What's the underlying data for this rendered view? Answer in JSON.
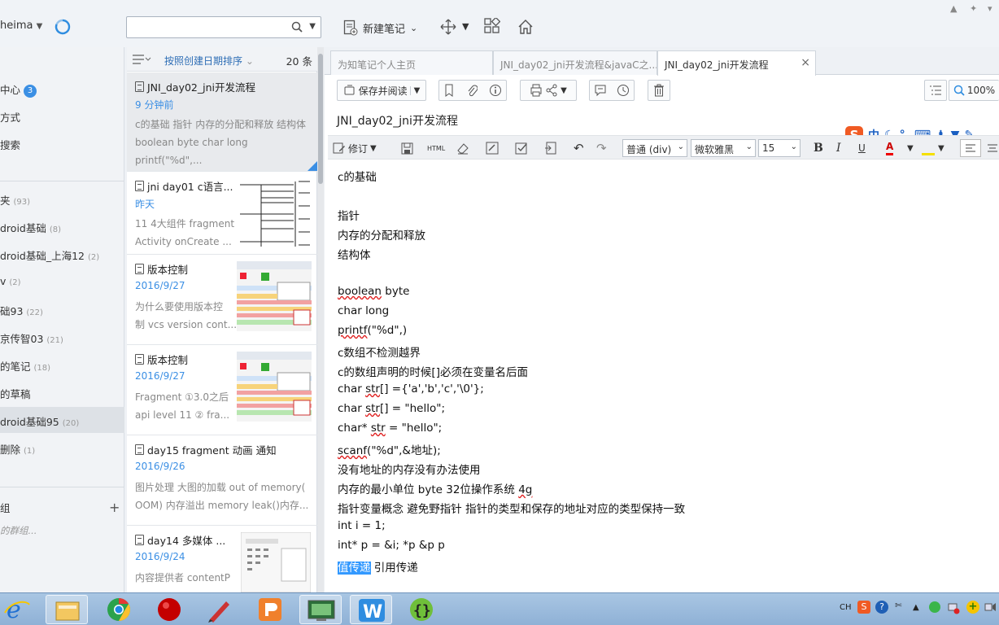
{
  "header": {
    "user": "heima",
    "search_placeholder": "",
    "new_note_label": "新建笔记"
  },
  "sidebar": {
    "items": [
      {
        "label": "中心",
        "badge": "3"
      },
      {
        "label": "方式"
      },
      {
        "label": "搜索"
      },
      {
        "label": "夹",
        "count": "(93)"
      },
      {
        "label": "droid基础",
        "count": "(8)"
      },
      {
        "label": "droid基础_上海12",
        "count": "(2)"
      },
      {
        "label": "v",
        "count": "(2)"
      },
      {
        "label": "础93",
        "count": "(22)"
      },
      {
        "label": "京传智03",
        "count": "(21)"
      },
      {
        "label": "的笔记",
        "count": "(18)"
      },
      {
        "label": "的草稿"
      },
      {
        "label": "droid基础95",
        "count": "(20)"
      },
      {
        "label": "删除",
        "count": "(1)"
      }
    ],
    "groups_label": "组",
    "groups_placeholder": "的群组..."
  },
  "notelist": {
    "sort_label": "按照创建日期排序",
    "count_label": "20 条",
    "notes": [
      {
        "title": "JNI_day02_jni开发流程",
        "date": "9 分钟前",
        "snippet1": "c的基础 指针 内存的分配和释放 结构体",
        "snippet2": "boolean byte char long printf(\"%d\",..."
      },
      {
        "title": "jni day01 c语言...",
        "date": "昨天",
        "snippet1": "11 4大组件 fragment",
        "snippet2": " Activity onCreate ..."
      },
      {
        "title": "版本控制",
        "date": "2016/9/27",
        "snippet1": "为什么要使用版本控",
        "snippet2": "制 vcs version cont..."
      },
      {
        "title": "版本控制",
        "date": "2016/9/27",
        "snippet1": "Fragment ①3.0之后",
        "snippet2": "api level 11 ② fra..."
      },
      {
        "title": "day15 fragment 动画 通知",
        "date": "2016/9/26",
        "snippet1": "图片处理 大图的加载 out of memory(",
        "snippet2": "OOM) 内存溢出 memory leak()内存..."
      },
      {
        "title": "day14 多媒体 ...",
        "date": "2016/9/24",
        "snippet1": "内容提供者 contentP",
        "snippet2": ""
      }
    ]
  },
  "tabs": [
    {
      "label": "为知笔记个人主页"
    },
    {
      "label": "JNI_day02_jni开发流程&javaC之..."
    },
    {
      "label": "JNI_day02_jni开发流程"
    }
  ],
  "actions": {
    "save_read": "保存并阅读",
    "zoom": "100%"
  },
  "note_title": "JNI_day02_jni开发流程",
  "format": {
    "edit_mode": "修订",
    "html_label": "HTML",
    "block": "普通 (div)",
    "font": "微软雅黑",
    "size": "15",
    "bold": "B",
    "italic": "I",
    "ime_label": "中"
  },
  "content": {
    "l1": "c的基础",
    "l2": "指针",
    "l3": "内存的分配和释放",
    "l4": "结构体",
    "l5a": "boolean",
    "l5b": " byte",
    "l6": "char  long",
    "l7a": "printf",
    "l7b": "(\"%d\",)",
    "l8": "c数组不检测越界",
    "l9": "c的数组声明的时候[]必须在变量名后面",
    "l10a": "char ",
    "l10b": "str",
    "l10c": "[]  ={'a','b','c','\\0'};",
    "l11a": "char ",
    "l11b": "str",
    "l11c": "[] = \"hello\";",
    "l12a": "char* ",
    "l12b": "str",
    "l12c": " = \"hello\";",
    "l13a": "scanf",
    "l13b": "(\"%d\",&地址);",
    "l14": "没有地址的内存没有办法使用",
    "l15a": "内存的最小单位 byte 32位操作系统 ",
    "l15b": "4g",
    "l16": "指针变量概念   避免野指针  指针的类型和保存的地址对应的类型保持一致",
    "l17": "int i = 1;",
    "l18": "int* p = &i;   *p &p p",
    "l19a": "值传递",
    "l19b": " 引用传递"
  },
  "tray": {
    "lang": "CH"
  }
}
